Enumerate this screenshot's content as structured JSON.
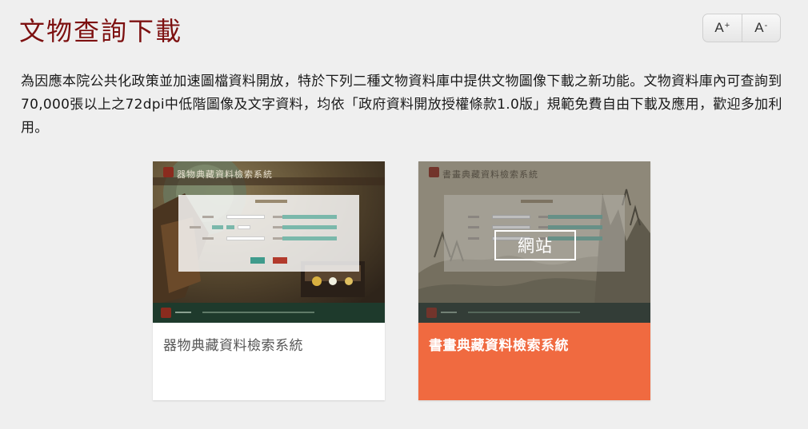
{
  "page": {
    "title": "文物查詢下載",
    "font_controls": {
      "increase_label": "A",
      "increase_sup": "+",
      "decrease_label": "A",
      "decrease_sup": "-"
    },
    "intro": "為因應本院公共化政策並加速圖檔資料開放，特於下列二種文物資料庫中提供文物圖像下載之新功能。文物資料庫內可查詢到70,000張以上之72dpi中低階圖像及文字資料，均依「政府資料開放授權條款1.0版」規範免費自由下載及應用，歡迎多加利用。"
  },
  "cards": [
    {
      "label": "器物典藏資料檢索系統",
      "thumb_title": "器物典藏資料檢索系統"
    },
    {
      "label": "書畫典藏資料檢索系統",
      "thumb_title": "書畫典藏資料檢索系統",
      "overlay_button": "網站"
    }
  ],
  "colors": {
    "title": "#7d1010",
    "active_card": "#f06a40",
    "thumb_footer": "#1e3a2c"
  }
}
